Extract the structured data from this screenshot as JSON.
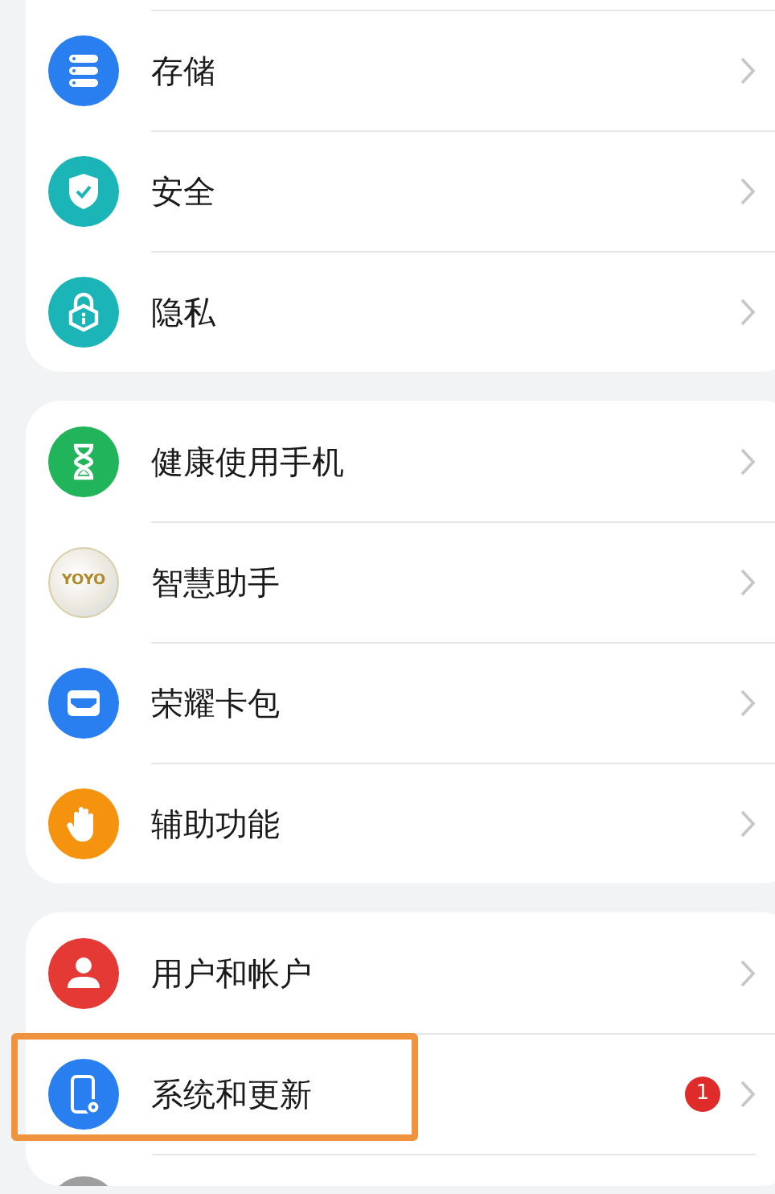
{
  "groups": [
    {
      "cut_top": true,
      "items": [
        {
          "kind": "storage",
          "color": "#2a7ff0",
          "label": "存储",
          "highlighted": false
        },
        {
          "kind": "shield",
          "color": "#1bb5b8",
          "label": "安全",
          "highlighted": false
        },
        {
          "kind": "lock",
          "color": "#1bb5b8",
          "label": "隐私",
          "highlighted": false
        }
      ]
    },
    {
      "cut_top": false,
      "items": [
        {
          "kind": "hourglass",
          "color": "#22b45a",
          "label": "健康使用手机",
          "highlighted": false
        },
        {
          "kind": "logo",
          "logo_text": "YOYO",
          "label": "智慧助手",
          "highlighted": false
        },
        {
          "kind": "wallet",
          "color": "#2a7ff0",
          "label": "荣耀卡包",
          "highlighted": false
        },
        {
          "kind": "hand",
          "color": "#f5930f",
          "label": "辅助功能",
          "highlighted": false
        }
      ]
    },
    {
      "cut_top": false,
      "items": [
        {
          "kind": "user",
          "color": "#e53935",
          "label": "用户和帐户",
          "highlighted": false
        },
        {
          "kind": "system",
          "color": "#2a7ff0",
          "label": "系统和更新",
          "badge": "1",
          "highlighted": true
        },
        {
          "kind": "stub",
          "color": "#9e9e9e"
        }
      ]
    }
  ]
}
